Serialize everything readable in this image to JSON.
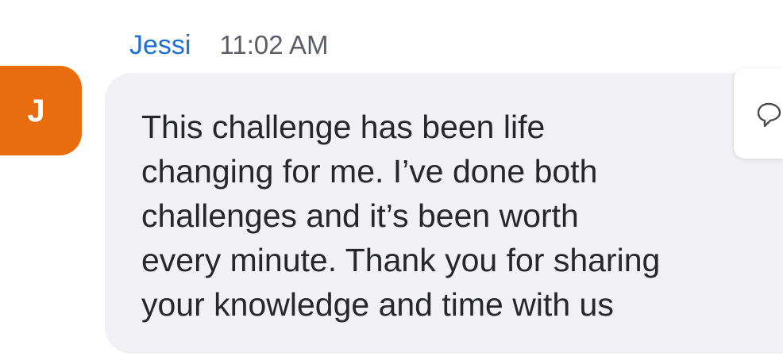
{
  "avatar": {
    "initial": "J",
    "color": "#e96c0f"
  },
  "message": {
    "sender": "Jessi",
    "time": "11:02 AM",
    "lines": [
      "This challenge has been life",
      "changing for me. I’ve done both",
      "challenges and it’s been worth",
      "every minute. Thank you for sharing",
      "your knowledge and time with us"
    ]
  },
  "actions": {
    "reply_icon": "reply-bubble-icon"
  },
  "colors": {
    "sender_name": "#1f6fd1",
    "bubble_bg": "#f1f1f5",
    "text": "#26272b"
  }
}
